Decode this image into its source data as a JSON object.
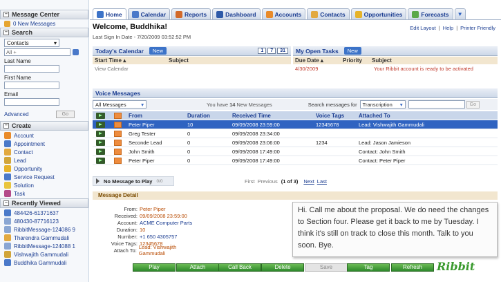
{
  "sidebar": {
    "message_center": {
      "title": "Message Center",
      "new_messages": "0 New Messages"
    },
    "search": {
      "title": "Search",
      "object": "Contacts",
      "all_value": "All +",
      "last_name_label": "Last Name",
      "first_name_label": "First Name",
      "email_label": "Email",
      "advanced_label": "Advanced",
      "go_label": "Go"
    },
    "create": {
      "title": "Create",
      "items": [
        {
          "label": "Account",
          "icon": "account-icon",
          "color": "#e98b2a"
        },
        {
          "label": "Appointment",
          "icon": "calendar-icon",
          "color": "#4a79c9"
        },
        {
          "label": "Contact",
          "icon": "contact-icon",
          "color": "#e2a940"
        },
        {
          "label": "Lead",
          "icon": "lead-icon",
          "color": "#d1a53a"
        },
        {
          "label": "Opportunity",
          "icon": "opportunity-icon",
          "color": "#e6b32a"
        },
        {
          "label": "Service Request",
          "icon": "service-icon",
          "color": "#4a79c9"
        },
        {
          "label": "Solution",
          "icon": "solution-icon",
          "color": "#e9c53e"
        },
        {
          "label": "Task",
          "icon": "task-icon",
          "color": "#b44a8a"
        }
      ]
    },
    "recent": {
      "title": "Recently Viewed",
      "items": [
        {
          "label": "484426-61371637",
          "icon": "contact-icon",
          "color": "#4a79c9"
        },
        {
          "label": "480430-87716123",
          "icon": "message-icon",
          "color": "#8aa6d3"
        },
        {
          "label": "RibbitMessage-124086 9",
          "icon": "message-icon",
          "color": "#8aa6d3"
        },
        {
          "label": "Tharendra Gammudali",
          "icon": "contact-icon",
          "color": "#e2a940"
        },
        {
          "label": "RibbitMessage-124088 1",
          "icon": "message-icon",
          "color": "#8aa6d3"
        },
        {
          "label": "Vishwajith Gammudali",
          "icon": "lead-icon",
          "color": "#d1a53a"
        },
        {
          "label": "Buddhika Gammudali",
          "icon": "contact-icon",
          "color": "#4a79c9"
        }
      ]
    }
  },
  "tabs": [
    {
      "label": "Home",
      "icon": "home-icon",
      "color": "#3c73c8"
    },
    {
      "label": "Calendar",
      "icon": "calendar-icon",
      "color": "#4a79c9"
    },
    {
      "label": "Reports",
      "icon": "reports-icon",
      "color": "#d26a2a"
    },
    {
      "label": "Dashboard",
      "icon": "dashboard-icon",
      "color": "#2e5aa8"
    },
    {
      "label": "Accounts",
      "icon": "accounts-icon",
      "color": "#e98b2a"
    },
    {
      "label": "Contacts",
      "icon": "contacts-icon",
      "color": "#e2a940"
    },
    {
      "label": "Opportunities",
      "icon": "opportunity-icon",
      "color": "#e6b32a"
    },
    {
      "label": "Forecasts",
      "icon": "forecast-icon",
      "color": "#5aa848"
    }
  ],
  "header": {
    "welcome": "Welcome, Buddhika!",
    "last_sign": "Last Sign In Date - 7/20/2009 03:52:52 PM",
    "links": [
      "Edit Layout",
      "Help",
      "Printer Friendly"
    ]
  },
  "calendar": {
    "title": "Today's Calendar",
    "new_label": "New",
    "view_buttons": [
      "1",
      "7",
      "31"
    ],
    "col_start": "Start Time",
    "col_subject": "Subject",
    "view_link": "View Calendar"
  },
  "tasks": {
    "title": "My Open Tasks",
    "new_label": "New",
    "col_due": "Due Date",
    "col_priority": "Priority",
    "col_subject": "Subject",
    "row_due": "4/30/2009",
    "row_subject": "Your Ribbit account is ready to be activated"
  },
  "voice": {
    "title": "Voice Messages",
    "filter": "All Messages",
    "count_prefix": "You have ",
    "count": "14",
    "count_suffix": " New Messages",
    "search_label": "Search messages for",
    "search_type": "Transcription",
    "go_label": "Go",
    "columns": [
      "From",
      "Duration",
      "Received Time",
      "Voice Tags",
      "Attached To"
    ],
    "rows": [
      {
        "from": "Peter Piper",
        "duration": "10",
        "received": "09/09/2008 23:59:00",
        "tags": "12345678",
        "attached": "Lead: Vishwajith Gammudali"
      },
      {
        "from": "Greg Tester",
        "duration": "0",
        "received": "09/09/2008 23:34:00",
        "tags": "",
        "attached": ""
      },
      {
        "from": "Seconde Lead",
        "duration": "0",
        "received": "09/09/2008 23:06:00",
        "tags": "1234",
        "attached": "Lead: Jason Jamieson"
      },
      {
        "from": "John Smith",
        "duration": "0",
        "received": "09/09/2008 17:49:00",
        "tags": "",
        "attached": "Contact: John Smith"
      },
      {
        "from": "Peter Piper",
        "duration": "0",
        "received": "09/09/2008 17:49:00",
        "tags": "",
        "attached": "Contact: Peter Piper"
      }
    ],
    "player_label": "No Message to Play",
    "player_time": "0/0",
    "pager_first": "First",
    "pager_prev": "Previous",
    "pager_info": "(1 of 3)",
    "pager_next": "Next",
    "pager_last": "Last"
  },
  "detail": {
    "title": "Message Detail",
    "fields": [
      {
        "key": "From:",
        "value": "Peter Piper"
      },
      {
        "key": "Received:",
        "value": "09/09/2008 23:59:00"
      },
      {
        "key": "Account:",
        "value": "ACME Computer Parts"
      },
      {
        "key": "Duration:",
        "value": "10"
      },
      {
        "key": "Number:",
        "value": "+1 650 4305757"
      },
      {
        "key": "Voice Tags:",
        "value": "12345678"
      },
      {
        "key": "Attach To:",
        "value": "Lead: Vishwajith Gammudali"
      }
    ],
    "transcription": "Hi. Call me about the proposal. We do need the changes to Section four. Please get it back to me by Tuesday. I think it's still on track to close this month. Talk to you soon. Bye.",
    "buttons": [
      "Play",
      "Attach",
      "Call Back",
      "Delete",
      "Save",
      "Tag",
      "Refresh"
    ],
    "brand": "Ribbit"
  }
}
